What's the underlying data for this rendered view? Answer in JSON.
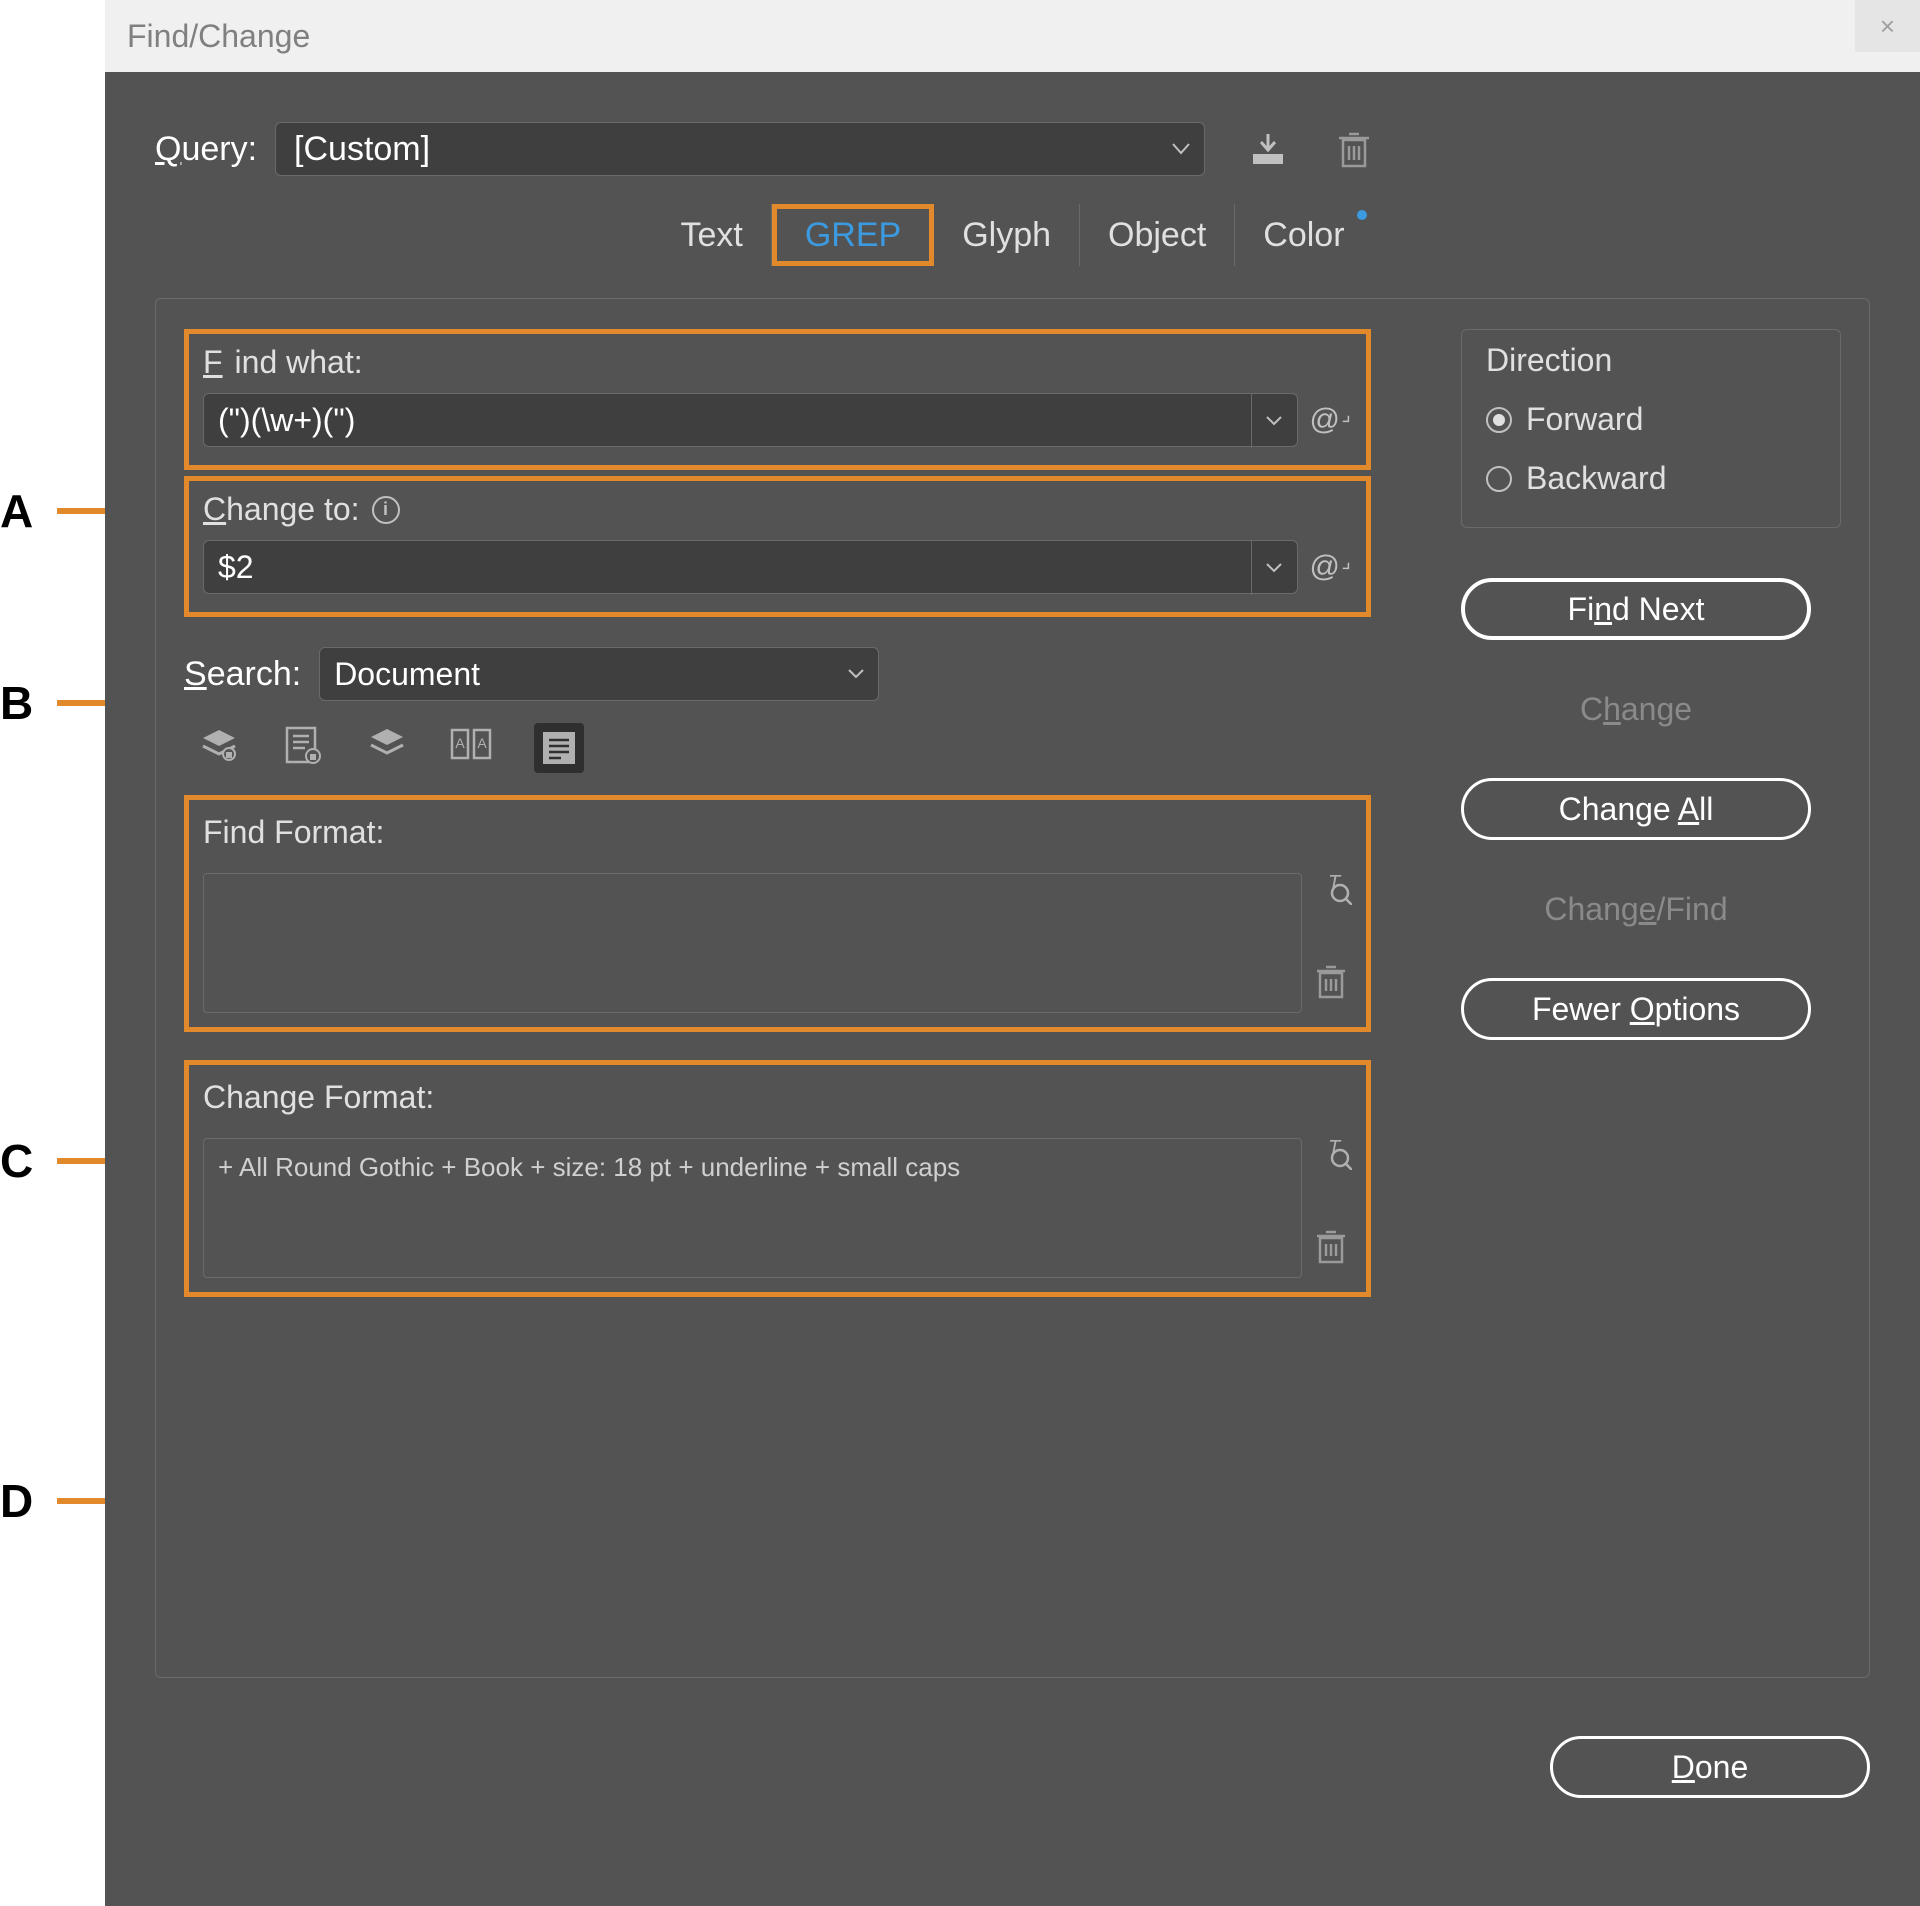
{
  "title": "Find/Change",
  "query": {
    "label": "Query:",
    "value": "[Custom]"
  },
  "tabs": {
    "text": "Text",
    "grep": "GREP",
    "glyph": "Glyph",
    "object": "Object",
    "color": "Color"
  },
  "find_what": {
    "label": "Find what:",
    "value": "(\")(\\w+)(\")"
  },
  "change_to": {
    "label": "Change to:",
    "value": "$2"
  },
  "search": {
    "label": "Search:",
    "value": "Document"
  },
  "find_format": {
    "label": "Find Format:",
    "value": ""
  },
  "change_format": {
    "label": "Change Format:",
    "value": "+ All Round Gothic + Book + size: 18 pt + underline + small caps"
  },
  "direction": {
    "label": "Direction",
    "forward": "Forward",
    "backward": "Backward"
  },
  "buttons": {
    "find_next": "Find Next",
    "change": "Change",
    "change_all": "Change All",
    "change_find": "Change/Find",
    "fewer_options": "Fewer Options",
    "done": "Done"
  },
  "callouts": {
    "A": "A",
    "B": "B",
    "C": "C",
    "D": "D"
  }
}
